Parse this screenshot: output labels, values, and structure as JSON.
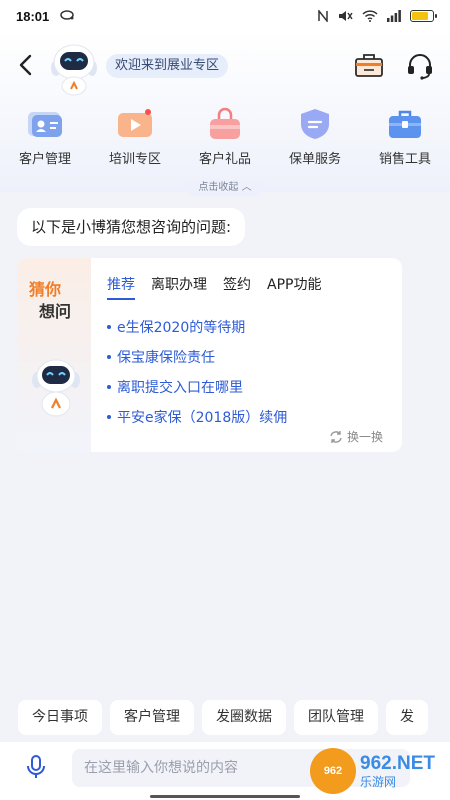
{
  "status": {
    "time": "18:01"
  },
  "header": {
    "welcome": "欢迎来到展业专区"
  },
  "quick_menu": [
    {
      "label": "客户管理",
      "icon": "customer-card-icon"
    },
    {
      "label": "培训专区",
      "icon": "video-play-icon"
    },
    {
      "label": "客户礼品",
      "icon": "gift-bag-icon"
    },
    {
      "label": "保单服务",
      "icon": "policy-shield-icon"
    },
    {
      "label": "销售工具",
      "icon": "toolbox-icon"
    }
  ],
  "collapse_label": "点击收起",
  "bot_message": "以下是小博猜您想咨询的问题:",
  "guess": {
    "title_1": "猜你",
    "title_2": "想问",
    "tabs": [
      "推荐",
      "离职办理",
      "签约",
      "APP功能"
    ],
    "active_tab": 0,
    "questions": [
      "e生保2020的等待期",
      "保宝康保险责任",
      "离职提交入口在哪里",
      "平安e家保（2018版）续佣"
    ],
    "refresh_label": "换一换"
  },
  "shortcuts": [
    "今日事项",
    "客户管理",
    "发圈数据",
    "团队管理",
    "发"
  ],
  "input": {
    "placeholder": "在这里输入你想说的内容"
  },
  "watermark": {
    "top": "962.NET",
    "bottom": "乐游网",
    "logo": "962"
  },
  "colors": {
    "accent": "#2e5bd6",
    "orange": "#f07d27",
    "battery": "#f2c40f"
  }
}
